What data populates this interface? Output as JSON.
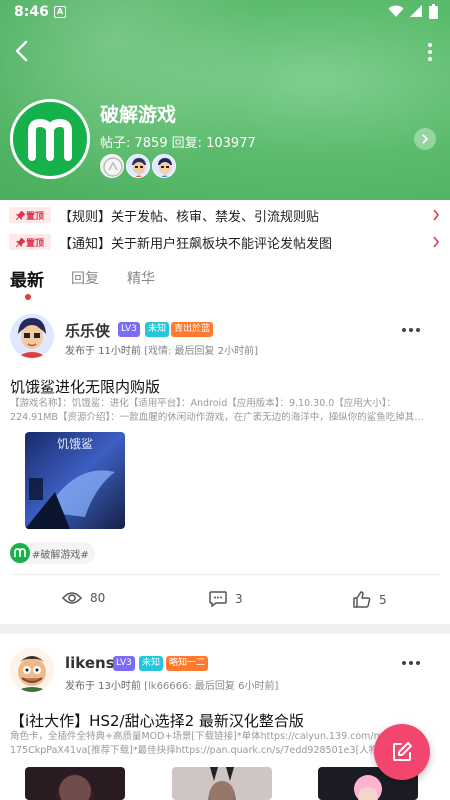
{
  "status_bar": {
    "time": "8:46",
    "notification": "A"
  },
  "forum": {
    "name": "破解游戏",
    "posts_label": "帖子: 7859",
    "replies_label": "回复: 103977"
  },
  "pinned": [
    {
      "badge": "置顶",
      "text": "【规则】关于发帖、核审、禁发、引流规则贴"
    },
    {
      "badge": "置顶",
      "text": "【通知】关于新用户狂飙板块不能评论发帖发图"
    }
  ],
  "tabs": [
    {
      "label": "最新",
      "active": true
    },
    {
      "label": "回复",
      "active": false
    },
    {
      "label": "精华",
      "active": false
    }
  ],
  "posts": [
    {
      "username": "乐乐侠",
      "level": "LV3",
      "badge1": "未知",
      "badge2": "青出於蓝",
      "time": "发布于 11小时前",
      "last_reply": "[戏情: 最后回复 2小时前]",
      "title": "饥饿鲨进化无限内购版",
      "desc": "【游戏名称】：饥饿鲨：进化【适用平台】：Android【应用版本】：9.10.30.0【应用大小】：224.91MB【资源介绍】：一款血腥的休闲动作游戏，在广袤无边的海洋中，操纵你的鲨鱼吃掉其…",
      "tag": "#破解游戏#",
      "views": "80",
      "comments": "3",
      "likes": "5",
      "thumb_text": "饥饿鲨"
    },
    {
      "username": "likens",
      "level": "LV3",
      "badge1": "未知",
      "badge2": "略知一二",
      "time": "发布于 13小时前",
      "last_reply": "[lk66666: 最后回复 6小时前]",
      "title": "【i社大作】HS2/甜心选择2 最新汉化整合版",
      "desc": "角色卡，全插件全特典+高质量MOD+场景[下载链接]*单体https://caiyun.139.com/m/i?175CkpPaX41va[推荐下载]*最佳抉择https://pan.quark.cn/s/7edd928501e3[人物…"
    }
  ],
  "colors": {
    "accent_green": "#5cbc6d",
    "fab": "#f3466f",
    "level_badge": "#7b6cf6",
    "unknown_badge": "#26c6da",
    "title_badge": "#ff7a2e"
  }
}
